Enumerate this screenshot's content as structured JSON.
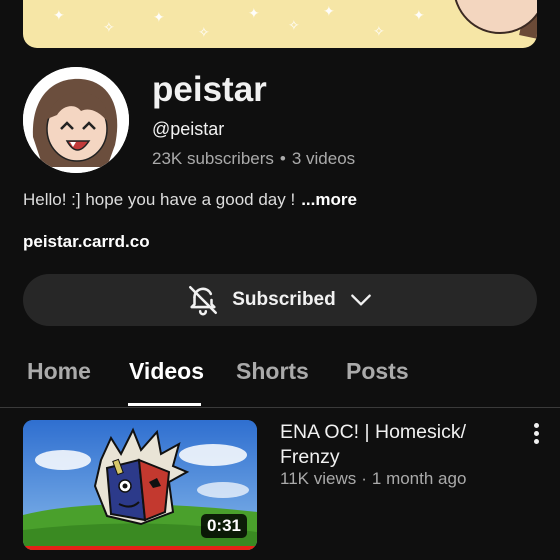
{
  "channel": {
    "name": "peistar",
    "handle": "@peistar",
    "subscribers": "23K subscribers",
    "separator": "•",
    "videos": "3 videos",
    "description": "Hello! :] hope you have a good day !",
    "more_label": "...more",
    "link": "peistar.carrd.co"
  },
  "subscribe": {
    "label": "Subscribed",
    "icon": "bell-off-icon",
    "chevron": "chevron-down-icon"
  },
  "tabs": [
    {
      "label": "Home",
      "active": false
    },
    {
      "label": "Videos",
      "active": true
    },
    {
      "label": "Shorts",
      "active": false
    },
    {
      "label": "Posts",
      "active": false
    }
  ],
  "videos": [
    {
      "title": "ENA OC! | Homesick/ Frenzy",
      "views": "11K views",
      "separator": "·",
      "age": "1 month ago",
      "duration": "0:31",
      "watched": 1.0
    }
  ],
  "colors": {
    "background": "#0f0f0f",
    "button_bg": "#272727",
    "secondary_text": "#aaaaaa",
    "progress": "#e62117",
    "banner": "#f6e6a6"
  }
}
